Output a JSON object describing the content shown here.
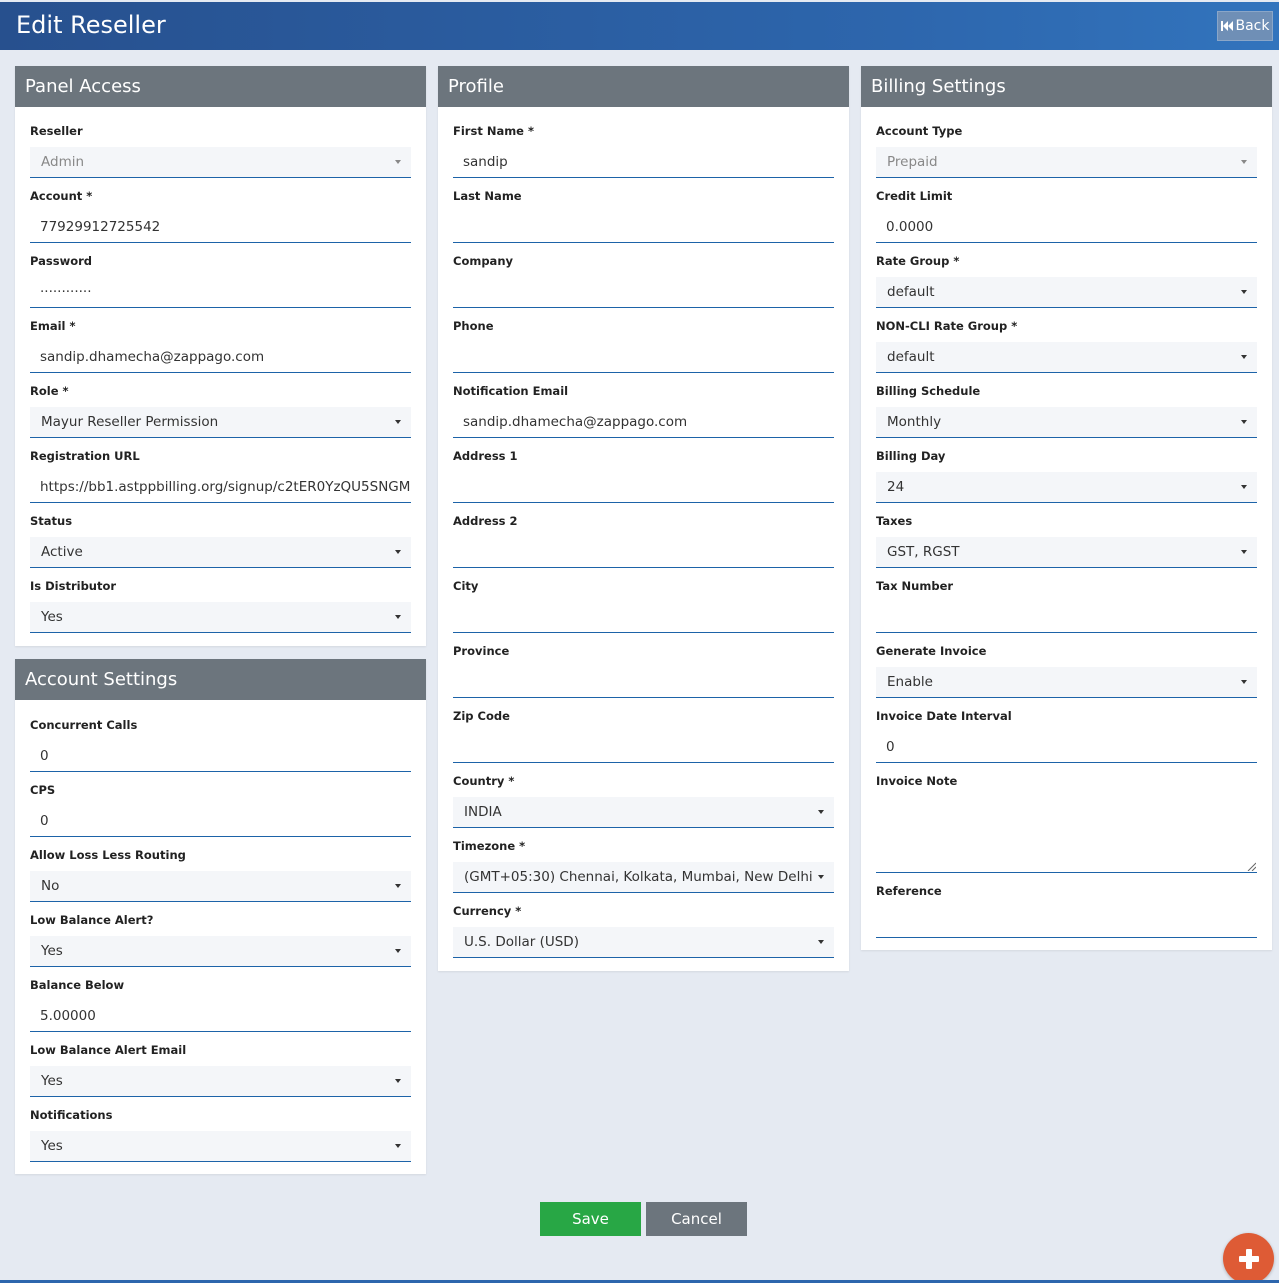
{
  "header": {
    "title": "Edit Reseller",
    "back_label": "Back"
  },
  "panel_access": {
    "title": "Panel Access",
    "fields": [
      {
        "label": "Reseller",
        "value": "Admin",
        "type": "select",
        "disabled": true
      },
      {
        "label": "Account *",
        "value": "77929912725542",
        "type": "input"
      },
      {
        "label": "Password",
        "value": "············",
        "type": "input"
      },
      {
        "label": "Email *",
        "value": "sandip.dhamecha@zappago.com",
        "type": "input"
      },
      {
        "label": "Role *",
        "value": "Mayur Reseller Permission",
        "type": "select"
      },
      {
        "label": "Registration URL",
        "value": "https://bb1.astppbilling.org/signup/c2tER0YzQU5SNGM",
        "type": "input"
      },
      {
        "label": "Status",
        "value": "Active",
        "type": "select"
      },
      {
        "label": "Is Distributor",
        "value": "Yes",
        "type": "select"
      }
    ]
  },
  "account_settings": {
    "title": "Account Settings",
    "fields": [
      {
        "label": "Concurrent Calls",
        "value": "0",
        "type": "input"
      },
      {
        "label": "CPS",
        "value": "0",
        "type": "input"
      },
      {
        "label": "Allow Loss Less Routing",
        "value": "No",
        "type": "select"
      },
      {
        "label": "Low Balance Alert?",
        "value": "Yes",
        "type": "select"
      },
      {
        "label": "Balance Below",
        "value": "5.00000",
        "type": "input"
      },
      {
        "label": "Low Balance Alert Email",
        "value": "Yes",
        "type": "select"
      },
      {
        "label": "Notifications",
        "value": "Yes",
        "type": "select"
      }
    ]
  },
  "profile": {
    "title": "Profile",
    "fields": [
      {
        "label": "First Name *",
        "value": "sandip",
        "type": "input"
      },
      {
        "label": "Last Name",
        "value": "",
        "type": "input"
      },
      {
        "label": "Company",
        "value": "",
        "type": "input"
      },
      {
        "label": "Phone",
        "value": "",
        "type": "input"
      },
      {
        "label": "Notification Email",
        "value": "sandip.dhamecha@zappago.com",
        "type": "input"
      },
      {
        "label": "Address 1",
        "value": "",
        "type": "input"
      },
      {
        "label": "Address 2",
        "value": "",
        "type": "input"
      },
      {
        "label": "City",
        "value": "",
        "type": "input"
      },
      {
        "label": "Province",
        "value": "",
        "type": "input"
      },
      {
        "label": "Zip Code",
        "value": "",
        "type": "input"
      },
      {
        "label": "Country *",
        "value": "INDIA",
        "type": "select"
      },
      {
        "label": "Timezone *",
        "value": "(GMT+05:30) Chennai, Kolkata, Mumbai, New Delhi",
        "type": "select"
      },
      {
        "label": "Currency *",
        "value": "U.S. Dollar (USD)",
        "type": "select"
      }
    ]
  },
  "billing": {
    "title": "Billing Settings",
    "fields": [
      {
        "label": "Account Type",
        "value": "Prepaid",
        "type": "select",
        "disabled": true
      },
      {
        "label": "Credit Limit",
        "value": "0.0000",
        "type": "input"
      },
      {
        "label": "Rate Group *",
        "value": "default",
        "type": "select"
      },
      {
        "label": "NON-CLI Rate Group *",
        "value": "default",
        "type": "select"
      },
      {
        "label": "Billing Schedule",
        "value": "Monthly",
        "type": "select"
      },
      {
        "label": "Billing Day",
        "value": "24",
        "type": "select"
      },
      {
        "label": "Taxes",
        "value": "GST, RGST",
        "type": "select"
      },
      {
        "label": "Tax Number",
        "value": "",
        "type": "input"
      },
      {
        "label": "Generate Invoice",
        "value": "Enable",
        "type": "select"
      },
      {
        "label": "Invoice Date Interval",
        "value": "0",
        "type": "input"
      },
      {
        "label": "Invoice Note",
        "value": "",
        "type": "textarea"
      },
      {
        "label": "Reference",
        "value": "",
        "type": "input"
      }
    ]
  },
  "actions": {
    "save_label": "Save",
    "cancel_label": "Cancel"
  },
  "colors": {
    "header": "#2d66ad",
    "panel_head": "#6c757d",
    "save": "#28a745",
    "cancel": "#6c757d",
    "fab": "#de5b35",
    "underline": "#1d63a8"
  },
  "icons": {
    "back": "skip-back-icon",
    "fab": "plus-icon"
  }
}
